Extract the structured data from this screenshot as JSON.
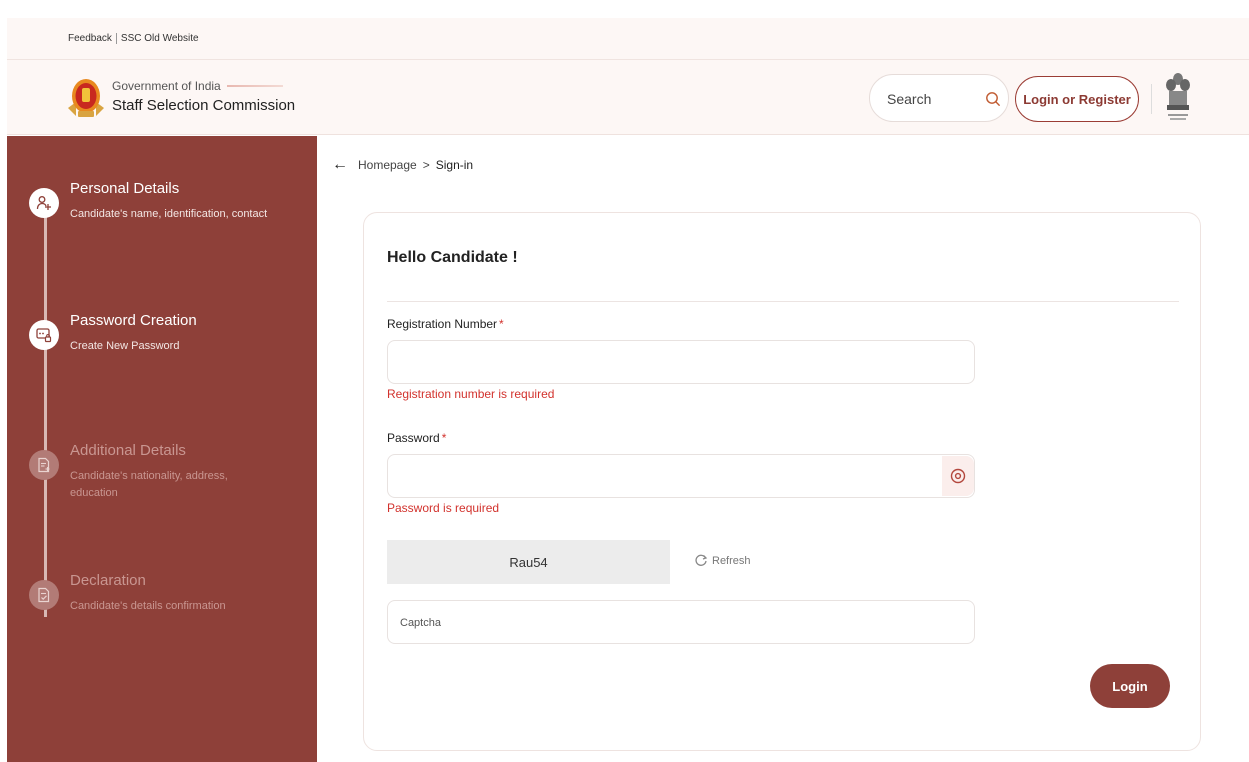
{
  "utility_links": {
    "feedback": "Feedback",
    "old_website": "SSC Old Website"
  },
  "brand": {
    "government": "Government of India",
    "commission": "Staff Selection Commission"
  },
  "header": {
    "search_placeholder": "Search",
    "login_register": "Login or Register"
  },
  "sidebar": {
    "steps": [
      {
        "title": "Personal Details",
        "desc": "Candidate's name, identification, contact",
        "icon": "user-add-icon",
        "state": "active"
      },
      {
        "title": "Password Creation",
        "desc": "Create New Password",
        "icon": "password-icon",
        "state": "active"
      },
      {
        "title": "Additional Details",
        "desc": "Candidate's nationality, address, education",
        "icon": "document-add-icon",
        "state": "inactive"
      },
      {
        "title": "Declaration",
        "desc": "Candidate's details confirmation",
        "icon": "document-check-icon",
        "state": "inactive"
      }
    ]
  },
  "breadcrumb": {
    "home": "Homepage",
    "separator": ">",
    "current": "Sign-in"
  },
  "form": {
    "heading": "Hello Candidate !",
    "registration_label": "Registration Number",
    "registration_value": "",
    "registration_error": "Registration number is required",
    "password_label": "Password",
    "password_value": "",
    "password_error": "Password is required",
    "required_mark": "*",
    "captcha_text": "Rau54",
    "refresh_label": "Refresh",
    "captcha_placeholder": "Captcha",
    "login_button": "Login"
  },
  "colors": {
    "brand": "#8e4039",
    "error": "#d2322d",
    "header_bg": "#fdf7f5"
  }
}
